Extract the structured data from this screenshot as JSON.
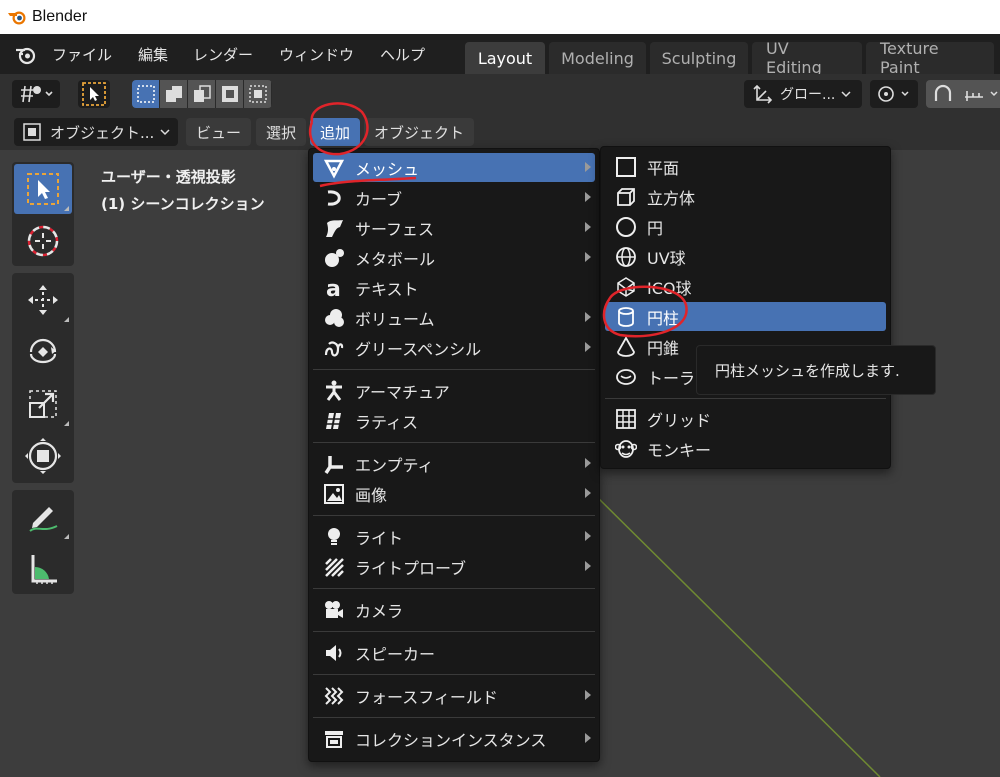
{
  "window": {
    "title": "Blender"
  },
  "menubar": {
    "items": [
      "ファイル",
      "編集",
      "レンダー",
      "ウィンドウ",
      "ヘルプ"
    ],
    "workspace_tabs": [
      "Layout",
      "Modeling",
      "Sculpting",
      "UV Editing",
      "Texture Paint"
    ],
    "active_tab": "Layout"
  },
  "header": {
    "mode_label": "オブジェクト...",
    "view_menus": [
      "ビュー",
      "選択",
      "追加",
      "オブジェクト"
    ],
    "active_menu": "追加",
    "transform_orientation": "グロー..."
  },
  "viewport": {
    "view_name": "ユーザー・透視投影",
    "collection": "(1) シーンコレクション"
  },
  "add_menu": {
    "items": [
      {
        "label": "メッシュ",
        "icon": "mesh-icon",
        "submenu": true,
        "highlighted": true
      },
      {
        "label": "カーブ",
        "icon": "curve-icon",
        "submenu": true
      },
      {
        "label": "サーフェス",
        "icon": "surface-icon",
        "submenu": true
      },
      {
        "label": "メタボール",
        "icon": "metaball-icon",
        "submenu": true
      },
      {
        "label": "テキスト",
        "icon": "text-icon",
        "submenu": false
      },
      {
        "label": "ボリューム",
        "icon": "volume-icon",
        "submenu": true
      },
      {
        "label": "グリースペンシル",
        "icon": "grease-pencil-icon",
        "submenu": true
      },
      {
        "label": "アーマチュア",
        "icon": "armature-icon",
        "submenu": false
      },
      {
        "label": "ラティス",
        "icon": "lattice-icon",
        "submenu": false
      },
      {
        "label": "エンプティ",
        "icon": "empty-icon",
        "submenu": true
      },
      {
        "label": "画像",
        "icon": "image-icon",
        "submenu": true
      },
      {
        "label": "ライト",
        "icon": "light-icon",
        "submenu": true
      },
      {
        "label": "ライトプローブ",
        "icon": "light-probe-icon",
        "submenu": true
      },
      {
        "label": "カメラ",
        "icon": "camera-icon",
        "submenu": false
      },
      {
        "label": "スピーカー",
        "icon": "speaker-icon",
        "submenu": false
      },
      {
        "label": "フォースフィールド",
        "icon": "force-field-icon",
        "submenu": true
      },
      {
        "label": "コレクションインスタンス",
        "icon": "collection-instance-icon",
        "submenu": true
      }
    ]
  },
  "mesh_menu": {
    "items": [
      {
        "label": "平面",
        "icon": "plane-icon"
      },
      {
        "label": "立方体",
        "icon": "cube-icon"
      },
      {
        "label": "円",
        "icon": "circle-icon"
      },
      {
        "label": "UV球",
        "icon": "uv-sphere-icon"
      },
      {
        "label": "ICO球",
        "icon": "ico-sphere-icon"
      },
      {
        "label": "円柱",
        "icon": "cylinder-icon",
        "highlighted": true
      },
      {
        "label": "円錐",
        "icon": "cone-icon"
      },
      {
        "label": "トーラス",
        "icon": "torus-icon"
      },
      {
        "label": "グリッド",
        "icon": "grid-icon"
      },
      {
        "label": "モンキー",
        "icon": "monkey-icon"
      }
    ]
  },
  "tooltip": {
    "text": "円柱メッシュを作成します."
  },
  "colors": {
    "accent": "#4772b3",
    "annotation": "#e0242a",
    "menu_bg": "#181818"
  }
}
